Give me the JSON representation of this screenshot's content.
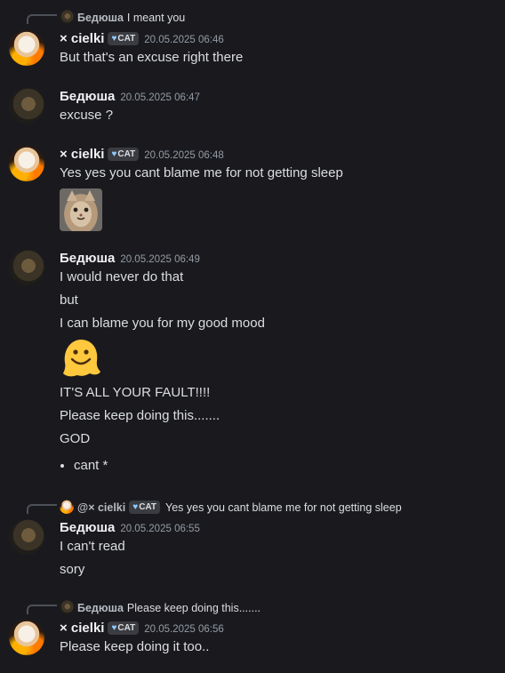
{
  "users": {
    "cielki": {
      "name": "× cielki",
      "tag": "CAT",
      "tag_icon": "heart-icon"
    },
    "bed": {
      "name": "Бедюша"
    }
  },
  "messages": [
    {
      "reply": {
        "name": "Бедюша",
        "text": "I meant you"
      },
      "author": "cielki",
      "time": "20.05.2025 06:46",
      "lines": [
        "But that's an excuse right there"
      ]
    },
    {
      "author": "bed",
      "time": "20.05.2025 06:47",
      "lines": [
        "excuse ?"
      ]
    },
    {
      "author": "cielki",
      "time": "20.05.2025 06:48",
      "lines": [
        "Yes yes you cant blame me for not getting sleep"
      ],
      "attachment": "cat-sticker"
    },
    {
      "author": "bed",
      "time": "20.05.2025 06:49",
      "lines": [
        "I would never do that",
        "but",
        "I can blame you for my good mood"
      ],
      "emoji": "melting-face-emoji",
      "lines2": [
        "IT'S ALL YOUR FAULT!!!!",
        "Please keep doing this.......",
        "GOD"
      ],
      "bullets": [
        "cant *"
      ]
    },
    {
      "reply": {
        "name": "@× cielki",
        "tag": "CAT",
        "text": "Yes yes you cant blame me for not getting sleep"
      },
      "author": "bed",
      "time": "20.05.2025 06:55",
      "lines": [
        "I can't read",
        "sory"
      ]
    },
    {
      "reply": {
        "name": "Бедюша",
        "text": "Please keep doing this......."
      },
      "author": "cielki",
      "time": "20.05.2025 06:56",
      "lines": [
        "Please keep doing it too.."
      ]
    }
  ],
  "colors": {
    "background": "#1a1a1e",
    "text": "#dbdee1",
    "muted": "#949ba4",
    "tag_bg": "#3a3c42",
    "melt_emoji": "#ffc83d"
  }
}
